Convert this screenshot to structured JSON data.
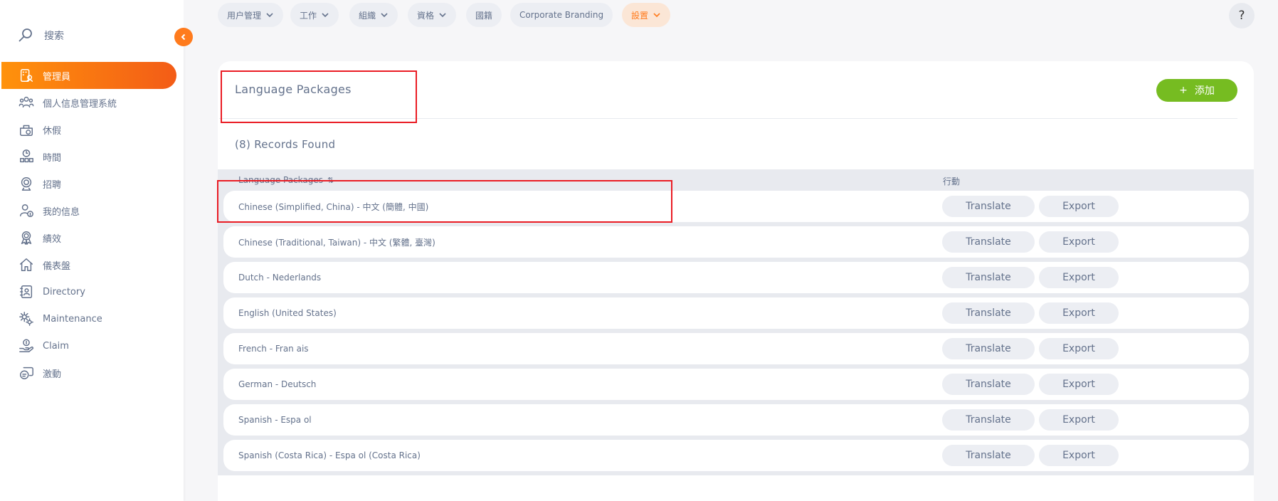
{
  "sidebar": {
    "search_label": "搜索",
    "items": [
      {
        "label": "管理員",
        "icon": "admin-icon",
        "active": true
      },
      {
        "label": "個人信息管理系統",
        "icon": "pim-icon",
        "active": false
      },
      {
        "label": "休假",
        "icon": "leave-icon",
        "active": false
      },
      {
        "label": "時間",
        "icon": "time-icon",
        "active": false
      },
      {
        "label": "招聘",
        "icon": "recruitment-icon",
        "active": false
      },
      {
        "label": "我的信息",
        "icon": "my-info-icon",
        "active": false
      },
      {
        "label": "績效",
        "icon": "performance-icon",
        "active": false
      },
      {
        "label": "儀表盤",
        "icon": "dashboard-icon",
        "active": false
      },
      {
        "label": "Directory",
        "icon": "directory-icon",
        "active": false
      },
      {
        "label": "Maintenance",
        "icon": "maintenance-icon",
        "active": false
      },
      {
        "label": "Claim",
        "icon": "claim-icon",
        "active": false
      },
      {
        "label": "激動",
        "icon": "buzz-icon",
        "active": false
      }
    ]
  },
  "topnav": [
    {
      "label": "用户管理",
      "dropdown": true,
      "active": false
    },
    {
      "label": "工作",
      "dropdown": true,
      "active": false
    },
    {
      "label": "組織",
      "dropdown": true,
      "active": false
    },
    {
      "label": "資格",
      "dropdown": true,
      "active": false
    },
    {
      "label": "國籍",
      "dropdown": false,
      "active": false
    },
    {
      "label": "Corporate Branding",
      "dropdown": false,
      "active": false
    },
    {
      "label": "設置",
      "dropdown": true,
      "active": true
    }
  ],
  "help_label": "?",
  "main": {
    "title": "Language Packages",
    "add_label": "添加",
    "add_plus": "+",
    "records": "(8) Records Found",
    "table": {
      "col_language": "Language Packages",
      "col_sort_icon": "⇅",
      "col_actions": "行動",
      "translate_label": "Translate",
      "export_label": "Export",
      "rows": [
        "Chinese (Simplified, China) - 中文 (簡體, 中國)",
        "Chinese (Traditional, Taiwan) - 中文 (繁體, 臺灣)",
        "Dutch - Nederlands",
        "English (United States)",
        "French - Fran  ais",
        "German - Deutsch",
        "Spanish - Espa  ol",
        "Spanish (Costa Rica) - Espa  ol (Costa Rica)"
      ]
    }
  },
  "colors": {
    "accent": "#ff7b1d",
    "add_button": "#76bc21",
    "annotation": "#ea1c24"
  }
}
